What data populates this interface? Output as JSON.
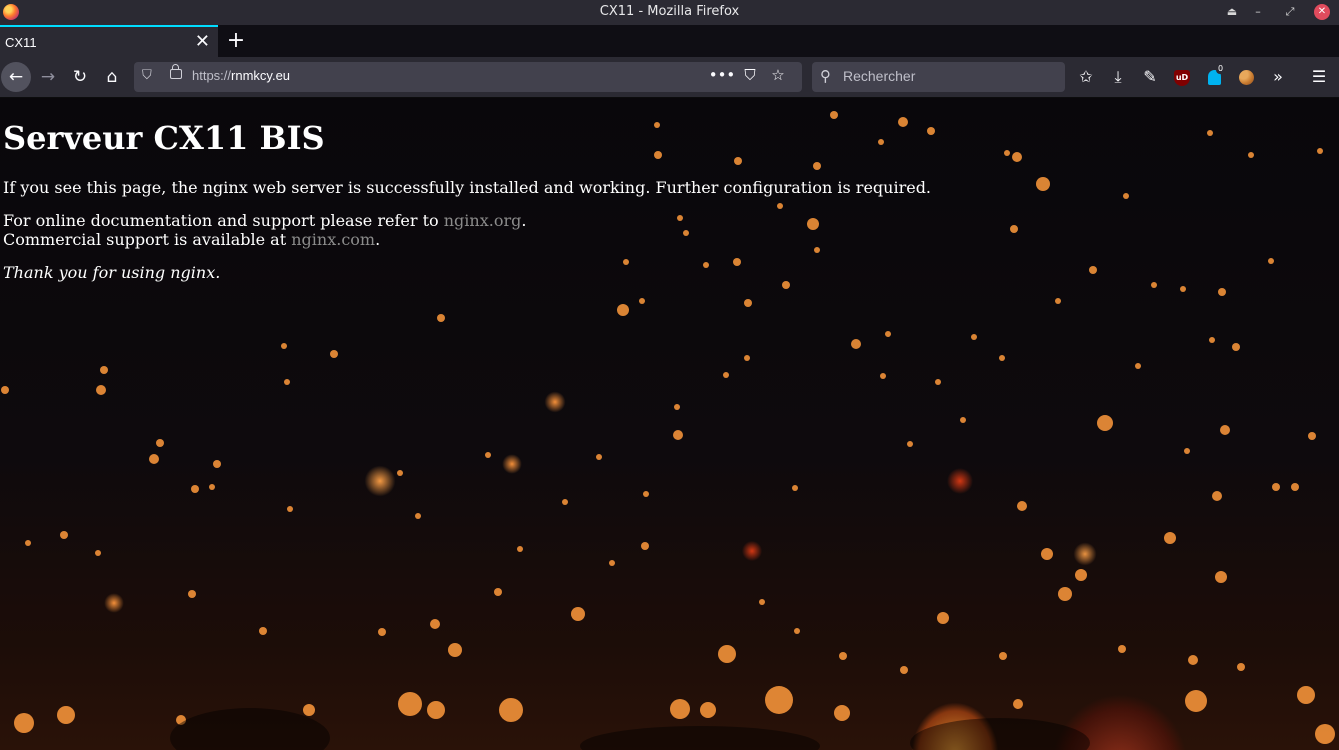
{
  "window": {
    "title": "CX11 - Mozilla Firefox"
  },
  "tabs": [
    {
      "label": "CX11",
      "active": true
    }
  ],
  "urlbar": {
    "protocol": "https://",
    "host": "rnmkcy.eu"
  },
  "search": {
    "placeholder": "Rechercher"
  },
  "toolbar": {
    "ublock_label": "uD",
    "extension_badge": "0"
  },
  "page": {
    "heading": "Serveur CX11 BIS",
    "intro": "If you see this page, the nginx web server is successfully installed and working. Further configuration is required.",
    "doc_prefix": "For online documentation and support please refer to ",
    "doc_link": "nginx.org",
    "doc_suffix": ".",
    "commercial_prefix": "Commercial support is available at ",
    "commercial_link": "nginx.com",
    "commercial_suffix": ".",
    "thanks": "Thank you for using nginx."
  },
  "colors": {
    "tab_accent": "#00ddff",
    "link": "#8b8b8b",
    "chrome_bg": "#2b2a33",
    "close_button": "#e04b5d"
  }
}
